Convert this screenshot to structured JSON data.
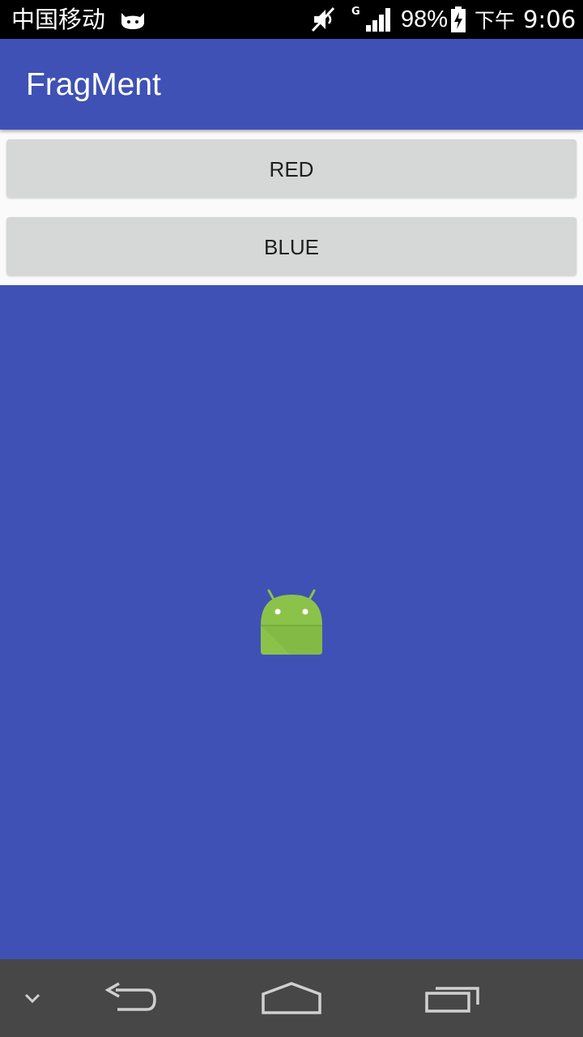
{
  "status_bar": {
    "carrier": "中国移动",
    "network_type": "G",
    "battery": "98%",
    "ampm": "下午",
    "time": "9:06",
    "icons": [
      "cat-notification-icon",
      "mute-icon",
      "signal-icon",
      "battery-charging-icon"
    ]
  },
  "app_bar": {
    "title": "FragMent",
    "color": "#3f51b5"
  },
  "buttons": {
    "red_label": "RED",
    "blue_label": "BLUE"
  },
  "fragment": {
    "background": "#3f51b5",
    "icon": "android-robot-icon"
  },
  "nav_bar": {
    "items": [
      "chevron-down-icon",
      "back-icon",
      "home-icon",
      "recent-apps-icon"
    ]
  }
}
